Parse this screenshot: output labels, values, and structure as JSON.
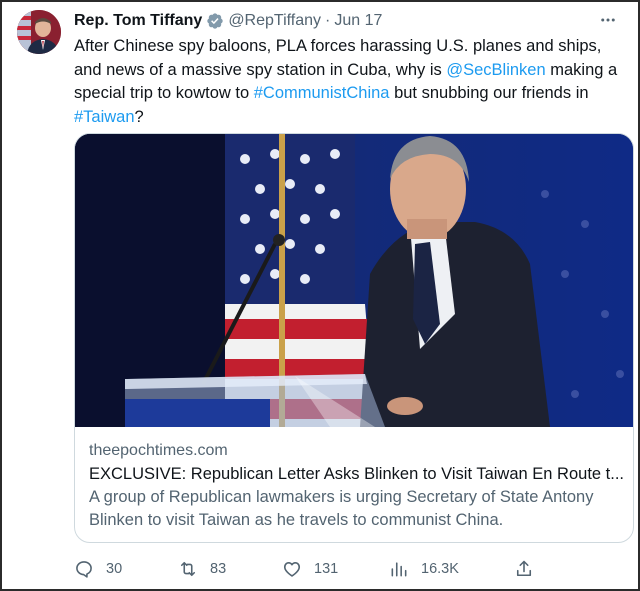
{
  "tweet": {
    "author_name": "Rep. Tom Tiffany",
    "handle": "@RepTiffany",
    "separator": "·",
    "date": "Jun 17",
    "text": {
      "part1": "After Chinese spy baloons, PLA forces harassing U.S. planes and ships, and news of a massive spy station in Cuba, why is ",
      "mention": "@SecBlinken",
      "part2": " making a special trip to kowtow to ",
      "hashtag1": "#CommunistChina",
      "part3": " but snubbing our friends in ",
      "hashtag2": "#Taiwan",
      "part4": "?"
    },
    "more_icon": "ellipsis-icon"
  },
  "link_card": {
    "domain": "theepochtimes.com",
    "title": "EXCLUSIVE: Republican Letter Asks Blinken to Visit Taiwan En Route t...",
    "description": "A group of Republican lawmakers is urging Secretary of State Antony Blinken to visit Taiwan as he travels to communist China."
  },
  "actions": {
    "replies": "30",
    "retweets": "83",
    "likes": "131",
    "views": "16.3K"
  },
  "colors": {
    "link": "#1d9bf0",
    "secondary_text": "#536471",
    "verified_badge": "#829aab"
  }
}
